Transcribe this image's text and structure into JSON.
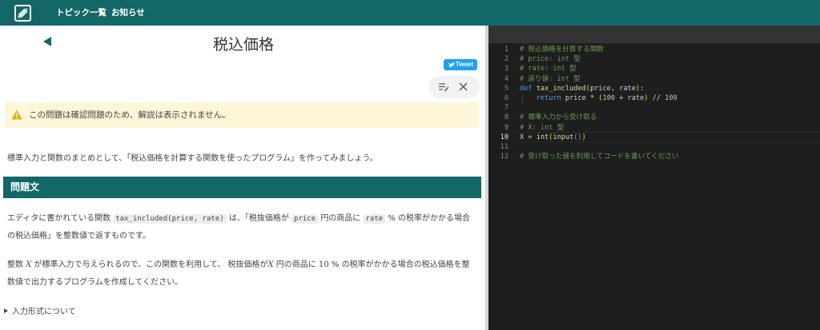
{
  "header": {
    "nav_topics": "トピック一覧",
    "nav_news": "お知らせ"
  },
  "page": {
    "title": "税込価格",
    "tweet_label": "Tweet"
  },
  "alert": {
    "text": "この問題は確認問題のため、解説は表示されません。"
  },
  "intro": "標準入力と関数のまとめとして、「税込価格を計算する関数を使ったプログラム」を作ってみましょう。",
  "section": {
    "heading": "問題文"
  },
  "problem": {
    "p1_a": "エディタに書かれている関数",
    "p1_code1": "tax_included(price, rate)",
    "p1_b": "は、「税抜価格が",
    "p1_code2": "price",
    "p1_c": "円の商品に",
    "p1_code3": "rate",
    "p1_d": "% の税率がかかる場合の税込価格」を整数値で返すものです。",
    "p2_a": "整数",
    "p2_var": "X",
    "p2_b": "が標準入力で与えられるので、この関数を利用して、 税抜価格が",
    "p2_var2": "X",
    "p2_c": "円の商品に",
    "p2_num": "10",
    "p2_d": "% の税率がかかる場合の税込価格を整数値で出力するプログラムを作成してください。"
  },
  "details": {
    "summary": "入力形式について"
  },
  "editor": {
    "current_line": 10,
    "lines": [
      {
        "n": "1",
        "tokens": [
          {
            "c": "cm",
            "t": "# 税込価格を計算する関数"
          }
        ]
      },
      {
        "n": "2",
        "tokens": [
          {
            "c": "cm",
            "t": "# price: int 型"
          }
        ]
      },
      {
        "n": "3",
        "tokens": [
          {
            "c": "cm",
            "t": "# rate: int 型"
          }
        ]
      },
      {
        "n": "4",
        "tokens": [
          {
            "c": "cm",
            "t": "# 返り値: int 型"
          }
        ]
      },
      {
        "n": "5",
        "tokens": [
          {
            "c": "kw",
            "t": "def "
          },
          {
            "c": "fn",
            "t": "tax_included"
          },
          {
            "c": "pr",
            "t": "("
          },
          {
            "c": "vr",
            "t": "price, rate"
          },
          {
            "c": "pr",
            "t": ")"
          },
          {
            "c": "vr",
            "t": ":"
          }
        ]
      },
      {
        "n": "6",
        "tokens": [
          {
            "c": "vr",
            "t": "    "
          },
          {
            "c": "kw",
            "t": "return "
          },
          {
            "c": "vr",
            "t": "price * "
          },
          {
            "c": "pr",
            "t": "("
          },
          {
            "c": "nm",
            "t": "100"
          },
          {
            "c": "vr",
            "t": " + rate"
          },
          {
            "c": "pr",
            "t": ")"
          },
          {
            "c": "vr",
            "t": " // "
          },
          {
            "c": "nm",
            "t": "100"
          }
        ]
      },
      {
        "n": "7",
        "tokens": []
      },
      {
        "n": "8",
        "tokens": [
          {
            "c": "cm",
            "t": "# 標準入力から受け取る"
          }
        ]
      },
      {
        "n": "9",
        "tokens": [
          {
            "c": "cm",
            "t": "# X: int 型"
          }
        ]
      },
      {
        "n": "10",
        "tokens": [
          {
            "c": "vr",
            "t": "X = "
          },
          {
            "c": "fn",
            "t": "int"
          },
          {
            "c": "pr",
            "t": "("
          },
          {
            "c": "fn",
            "t": "input"
          },
          {
            "c": "kw",
            "t": "()"
          },
          {
            "c": "pr",
            "t": ")"
          }
        ]
      },
      {
        "n": "11",
        "tokens": []
      },
      {
        "n": "12",
        "tokens": [
          {
            "c": "cm",
            "t": "# 受け取った値を利用してコードを書いてください"
          }
        ]
      }
    ]
  },
  "colors": {
    "brand": "#136766",
    "alert_bg": "#fdf6d8",
    "warning": "#e2b007",
    "tweet": "#1da1f2",
    "editor_bg": "#1e1e1e"
  }
}
